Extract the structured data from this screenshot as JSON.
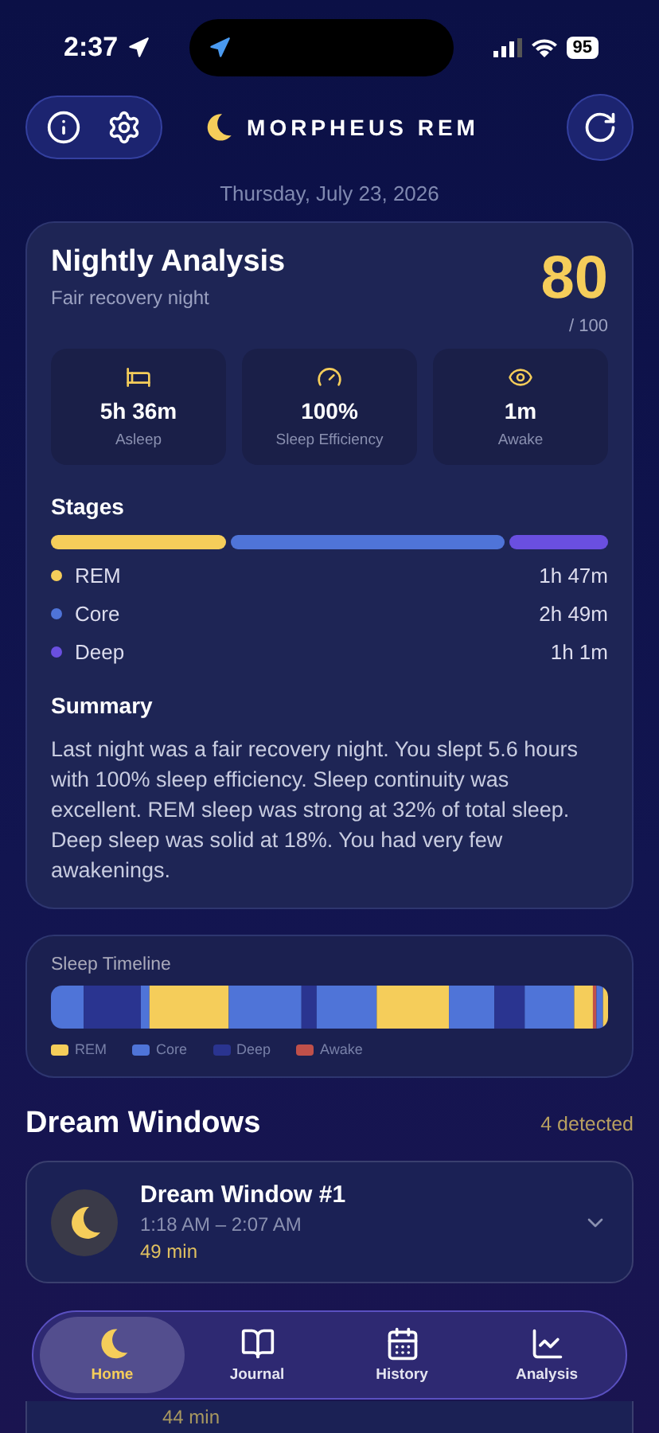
{
  "status_bar": {
    "time": "2:37",
    "battery": "95"
  },
  "header": {
    "title": "MORPHEUS REM",
    "date": "Thursday, July 23, 2026"
  },
  "analysis": {
    "title": "Nightly Analysis",
    "subtitle": "Fair recovery night",
    "score": "80",
    "score_max": "/ 100",
    "metrics": [
      {
        "kind": "bed",
        "value": "5h 36m",
        "label": "Asleep"
      },
      {
        "kind": "gauge",
        "value": "100%",
        "label": "Sleep Efficiency"
      },
      {
        "kind": "eye",
        "value": "1m",
        "label": "Awake"
      }
    ],
    "stages_title": "Stages",
    "stages": [
      {
        "name": "REM",
        "duration": "1h 47m",
        "color": "#f5cd5a"
      },
      {
        "name": "Core",
        "duration": "2h 49m",
        "color": "#4f74d8"
      },
      {
        "name": "Deep",
        "duration": "1h 1m",
        "color": "#6a4fe0"
      }
    ],
    "summary_title": "Summary",
    "summary": "Last night was a fair recovery night. You slept 5.6 hours with 100% sleep efficiency. Sleep continuity was excellent. REM sleep was strong at 32% of total sleep. Deep sleep was solid at 18%. You had very few awakenings."
  },
  "timeline": {
    "title": "Sleep Timeline",
    "legend": [
      {
        "label": "REM",
        "color": "#f5cd5a"
      },
      {
        "label": "Core",
        "color": "#4f74d8"
      },
      {
        "label": "Deep",
        "color": "#2a3490"
      },
      {
        "label": "Awake",
        "color": "#c0504a"
      }
    ]
  },
  "dream_windows": {
    "title": "Dream Windows",
    "count": "4 detected",
    "items": [
      {
        "title": "Dream Window #1",
        "time": "1:18 AM – 2:07 AM",
        "duration": "49 min"
      },
      {
        "duration": "44 min"
      }
    ]
  },
  "nav": [
    {
      "kind": "moon",
      "label": "Home",
      "selected": true
    },
    {
      "kind": "book",
      "label": "Journal",
      "selected": false
    },
    {
      "kind": "calendar",
      "label": "History",
      "selected": false
    },
    {
      "kind": "chart",
      "label": "Analysis",
      "selected": false
    }
  ]
}
